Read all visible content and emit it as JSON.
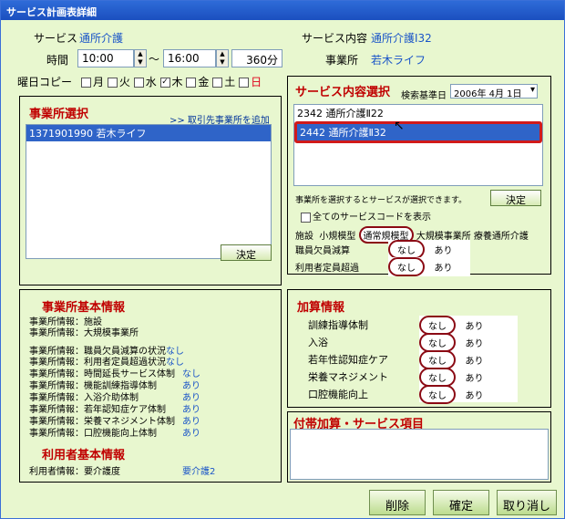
{
  "window": {
    "title": "サービス計画表詳細"
  },
  "header": {
    "service_label": "サービス",
    "service_value": "通所介護",
    "content_label": "サービス内容",
    "content_value": "通所介護Ⅰ32",
    "office_label": "事業所",
    "office_value": "若木ライフ"
  },
  "time": {
    "label": "時間",
    "start": "10:00",
    "tilde": "～",
    "end": "16:00",
    "duration": "360分"
  },
  "weekday": {
    "label": "曜日コピー",
    "days": [
      {
        "label": "月",
        "checked": false
      },
      {
        "label": "火",
        "checked": false
      },
      {
        "label": "水",
        "checked": true
      },
      {
        "label": "木",
        "checked": false
      },
      {
        "label": "金",
        "checked": false
      },
      {
        "label": "土",
        "checked": false
      },
      {
        "label": "日",
        "checked": false
      }
    ]
  },
  "office_select": {
    "title": "事業所選択",
    "add_link": ">> 取引先事業所を追加",
    "items": [
      "1371901990 若木ライフ"
    ],
    "decide": "決定"
  },
  "service_select": {
    "title": "サービス内容選択",
    "date_label": "検索基準日",
    "date_value": "2006年 4月 1日",
    "items": [
      "2342 通所介護Ⅱ22",
      "2442 通所介護Ⅱ32"
    ],
    "hint": "事業所を選択するとサービスが選択できます。",
    "decide": "決定",
    "show_all": "全てのサービスコードを表示",
    "facility_label": "施設",
    "facility_opts": [
      "小規模型",
      "通常規模型",
      "大規模事業所",
      "療養通所介護"
    ],
    "staff_label": "職員欠員減算",
    "capacity_label": "利用者定員超過",
    "none": "なし",
    "yes": "あり"
  },
  "office_info": {
    "title": "事業所基本情報",
    "rows": [
      {
        "k": "事業所情報：施設",
        "v": ""
      },
      {
        "k": "事業所情報：大規模事業所",
        "v": ""
      },
      {
        "k": "事業所情報：職員欠員減算の状況",
        "v": "なし"
      },
      {
        "k": "事業所情報：利用者定員超過状況",
        "v": "なし"
      },
      {
        "k": "事業所情報：時間延長サービス体制",
        "v": "なし"
      },
      {
        "k": "事業所情報：機能訓練指導体制",
        "v": "あり"
      },
      {
        "k": "事業所情報：入浴介助体制",
        "v": "あり"
      },
      {
        "k": "事業所情報：若年認知症ケア体制",
        "v": "あり"
      },
      {
        "k": "事業所情報：栄養マネジメント体制",
        "v": "あり"
      },
      {
        "k": "事業所情報：口腔機能向上体制",
        "v": "あり"
      }
    ]
  },
  "user_info": {
    "title": "利用者基本情報",
    "k": "利用者情報：要介護度",
    "v": "要介護2"
  },
  "addition": {
    "title": "加算情報",
    "rows": [
      "訓練指導体制",
      "入浴",
      "若年性認知症ケア",
      "栄養マネジメント",
      "口腔機能向上"
    ],
    "none": "なし",
    "yes": "あり"
  },
  "extra": {
    "title": "付帯加算・サービス項目"
  },
  "footer": {
    "delete": "削除",
    "confirm": "確定",
    "cancel": "取り消し"
  }
}
